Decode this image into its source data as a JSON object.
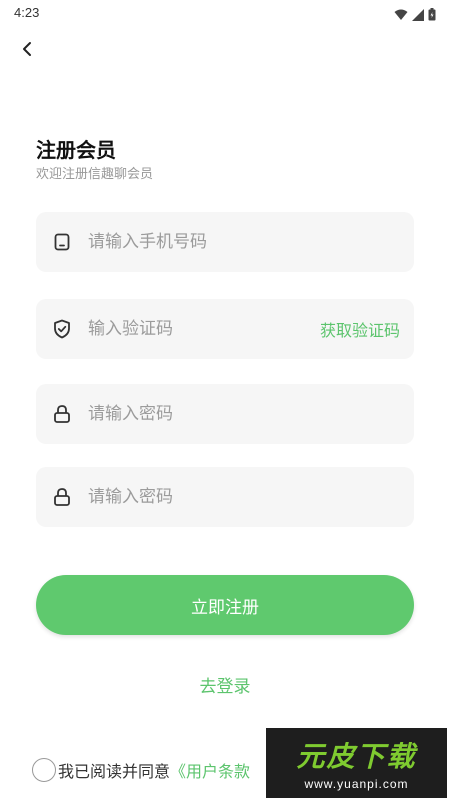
{
  "status_bar": {
    "time": "4:23"
  },
  "header": {
    "title": "注册会员",
    "subtitle": "欢迎注册信趣聊会员"
  },
  "form": {
    "phone_placeholder": "请输入手机号码",
    "code_placeholder": "输入验证码",
    "get_code_label": "获取验证码",
    "password_placeholder": "请输入密码",
    "confirm_password_placeholder": "请输入密码"
  },
  "actions": {
    "register_label": "立即注册",
    "login_label": "去登录"
  },
  "agreement": {
    "prefix": "我已阅读并同意",
    "terms_link": "《用户条款"
  },
  "watermark": {
    "main": "元皮下载",
    "url": "www.yuanpi.com"
  },
  "colors": {
    "accent": "#5fc96e",
    "field_bg": "#f6f6f6"
  },
  "icons": [
    "wifi-icon",
    "signal-icon",
    "battery-icon",
    "back-arrow-icon",
    "phone-icon",
    "shield-check-icon",
    "lock-icon"
  ]
}
